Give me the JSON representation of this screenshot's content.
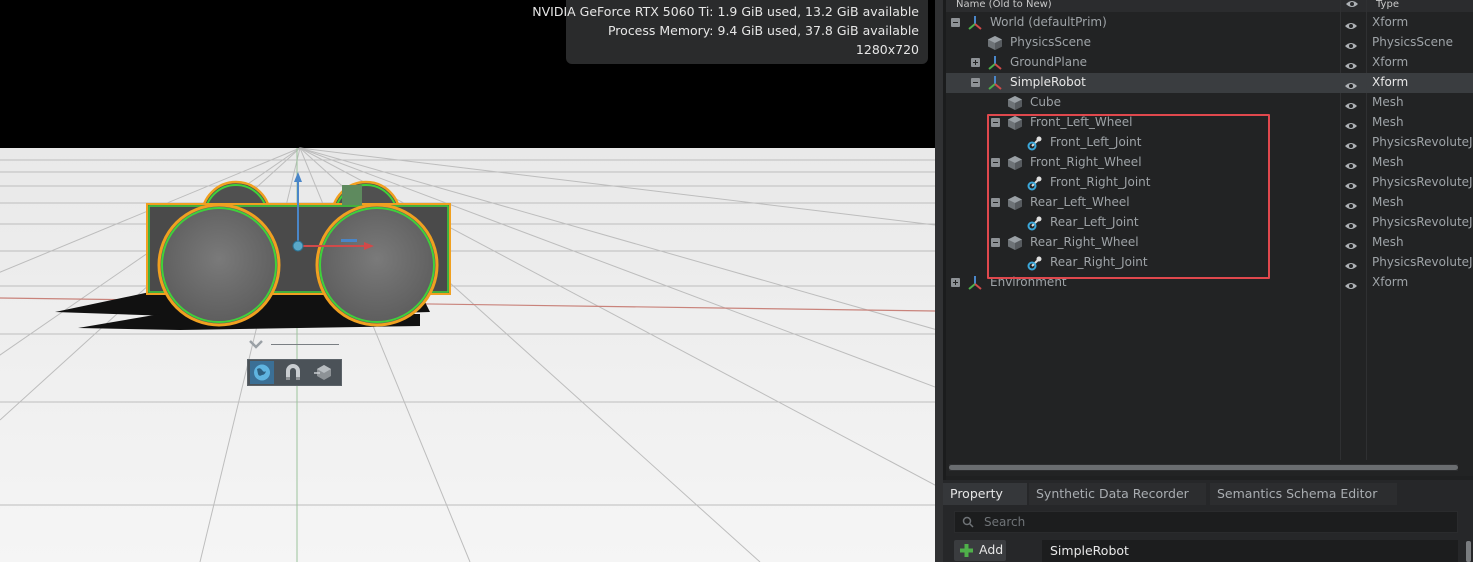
{
  "viewport": {
    "hud": {
      "gpu": "NVIDIA GeForce RTX 5060 Ti: 1.9 GiB used, 13.2 GiB available",
      "memory": "Process Memory: 9.4 GiB used, 37.8 GiB available",
      "resolution": "1280x720"
    },
    "gizmo_tools": [
      "globe-icon",
      "magnet-icon",
      "cube-snap-icon"
    ]
  },
  "stage": {
    "header": {
      "name": "Name (Old to New)",
      "eye_icon": "eye-icon",
      "type": "Type"
    },
    "rows": [
      {
        "name": "World (defaultPrim)",
        "type": "Xform",
        "icon": "xform-icon",
        "expander": "minus"
      },
      {
        "name": "PhysicsScene",
        "type": "PhysicsScene",
        "icon": "cube-icon",
        "expander": "none"
      },
      {
        "name": "GroundPlane",
        "type": "Xform",
        "icon": "xform-icon",
        "expander": "plus"
      },
      {
        "name": "SimpleRobot",
        "type": "Xform",
        "icon": "xform-icon",
        "expander": "minus",
        "selected": true
      },
      {
        "name": "Cube",
        "type": "Mesh",
        "icon": "cube-icon",
        "expander": "none"
      },
      {
        "name": "Front_Left_Wheel",
        "type": "Mesh",
        "icon": "cube-icon",
        "expander": "minus"
      },
      {
        "name": "Front_Left_Joint",
        "type": "PhysicsRevoluteJoint",
        "icon": "joint-icon",
        "expander": "none"
      },
      {
        "name": "Front_Right_Wheel",
        "type": "Mesh",
        "icon": "cube-icon",
        "expander": "minus"
      },
      {
        "name": "Front_Right_Joint",
        "type": "PhysicsRevoluteJoint",
        "icon": "joint-icon",
        "expander": "none"
      },
      {
        "name": "Rear_Left_Wheel",
        "type": "Mesh",
        "icon": "cube-icon",
        "expander": "minus"
      },
      {
        "name": "Rear_Left_Joint",
        "type": "PhysicsRevoluteJoint",
        "icon": "joint-icon",
        "expander": "none"
      },
      {
        "name": "Rear_Right_Wheel",
        "type": "Mesh",
        "icon": "cube-icon",
        "expander": "minus"
      },
      {
        "name": "Rear_Right_Joint",
        "type": "PhysicsRevoluteJoint",
        "icon": "joint-icon",
        "expander": "none"
      },
      {
        "name": "Environment",
        "type": "Xform",
        "icon": "xform-icon",
        "expander": "plus"
      }
    ]
  },
  "property": {
    "tabs": [
      "Property",
      "Synthetic Data Recorder",
      "Semantics Schema Editor"
    ],
    "search_placeholder": "Search",
    "add_label": "Add",
    "prim_name": "SimpleRobot"
  },
  "colors": {
    "highlight_box": "#e0484d",
    "selection_outline": "#f0a020",
    "selection_inner": "#3fd13a",
    "accent_blue": "#3ba7d9"
  }
}
